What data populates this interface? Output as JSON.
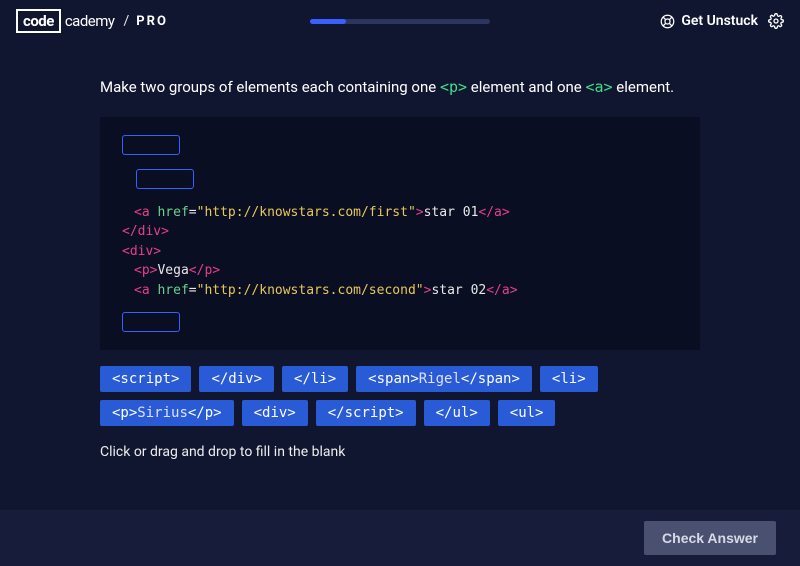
{
  "header": {
    "logo_box": "code",
    "logo_rest": "cademy",
    "logo_pro": "PRO",
    "get_unstuck": "Get Unstuck",
    "progress_pct": 20
  },
  "prompt": {
    "pre": "Make two groups of elements each containing one ",
    "tag1": "<p>",
    "mid": " element and one ",
    "tag2": "<a>",
    "post": " element."
  },
  "code": {
    "a_open": "<a",
    "a_close": "</a>",
    "div_open": "<div>",
    "div_close": "</div>",
    "p_open": "<p>",
    "p_close": "</p>",
    "href": " href",
    "eq": "=",
    "url1": "\"http://knowstars.com/first\"",
    "url2": "\"http://knowstars.com/second\"",
    "gt": ">",
    "star01": "star 01",
    "star02": "star 02",
    "vega": "Vega"
  },
  "options": [
    {
      "html": "<script>",
      "kind": "tag"
    },
    {
      "html": "</div>",
      "kind": "tag"
    },
    {
      "html": "</li>",
      "kind": "tag"
    },
    {
      "html": "<span>Rigel</span>",
      "kind": "mixed",
      "open": "<span>",
      "text": "Rigel",
      "close": "</span>"
    },
    {
      "html": "<li>",
      "kind": "tag"
    },
    {
      "html": "<p>Sirius</p>",
      "kind": "mixed",
      "open": "<p>",
      "text": "Sirius",
      "close": "</p>"
    },
    {
      "html": "<div>",
      "kind": "tag"
    },
    {
      "html": "</script>",
      "kind": "tag"
    },
    {
      "html": "</ul>",
      "kind": "tag"
    },
    {
      "html": "<ul>",
      "kind": "tag"
    }
  ],
  "hint": "Click or drag and drop to fill in the blank",
  "footer": {
    "check": "Check Answer"
  }
}
